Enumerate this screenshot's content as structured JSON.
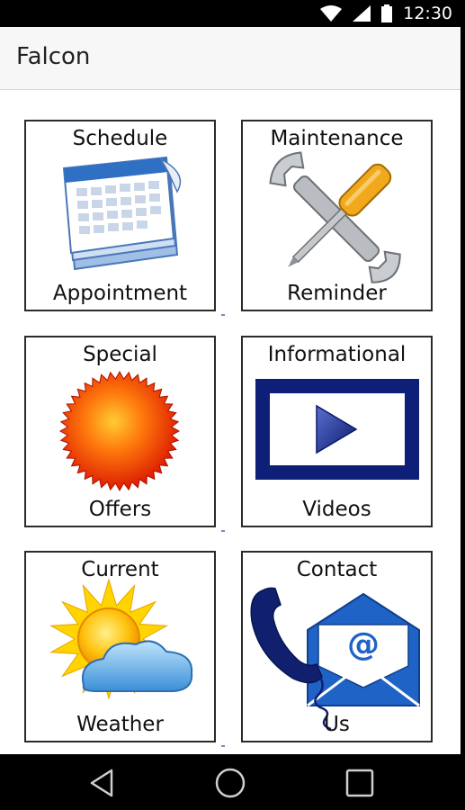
{
  "status": {
    "time": "12:30"
  },
  "app": {
    "title": "Falcon"
  },
  "tiles": [
    {
      "top": "Schedule",
      "bottom": "Appointment"
    },
    {
      "top": "Maintenance",
      "bottom": "Reminder"
    },
    {
      "top": "Special",
      "bottom": "Offers"
    },
    {
      "top": "Informational",
      "bottom": "Videos"
    },
    {
      "top": "Current",
      "bottom": "Weather"
    },
    {
      "top": "Contact",
      "bottom": "Us"
    }
  ]
}
